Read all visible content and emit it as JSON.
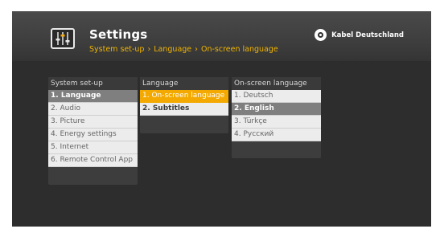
{
  "header": {
    "title": "Settings",
    "icon": "equalizer-icon",
    "breadcrumb": [
      "System set-up",
      "Language",
      "On-screen language"
    ],
    "breadcrumb_separator": "›",
    "brand": "Kabel Deutschland",
    "brand_icon": "kabel-deutschland-logo"
  },
  "columns": [
    {
      "title": "System set-up",
      "items": [
        "1. Language",
        "2. Audio",
        "3. Picture",
        "4. Energy settings",
        "5. Internet",
        "6. Remote Control App"
      ]
    },
    {
      "title": "Language",
      "items": [
        "1. On-screen language",
        "2. Subtitles"
      ]
    },
    {
      "title": "On-screen language",
      "items": [
        "1. Deutsch",
        "2. English",
        "3. Türkçe",
        "4. Русский"
      ]
    }
  ],
  "colors": {
    "accent": "#f3a900",
    "breadcrumb": "#f0b400",
    "selected": "#7f7f7f",
    "background": "#2d2d2d"
  }
}
